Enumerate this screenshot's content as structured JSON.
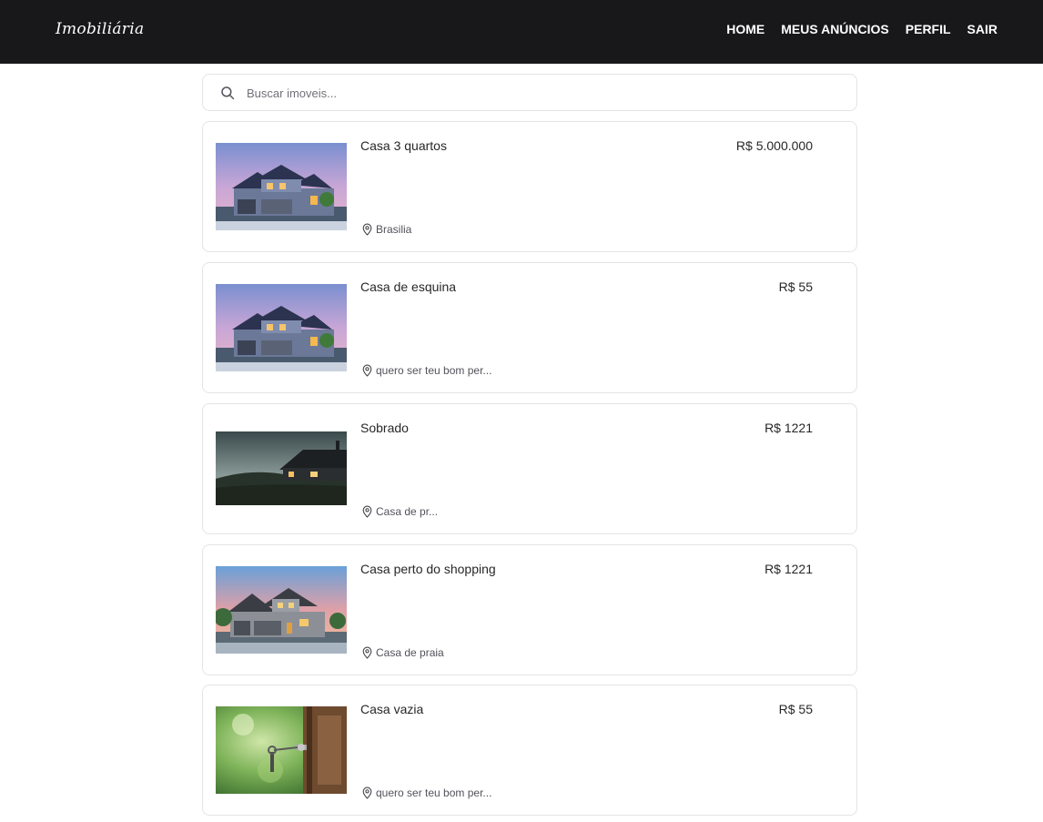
{
  "navbar": {
    "brand": "Imobiliária",
    "links": [
      "HOME",
      "MEUS ANÚNCIOS",
      "PERFIL",
      "SAIR"
    ]
  },
  "search": {
    "placeholder": "Buscar imoveis...",
    "value": ""
  },
  "listings": [
    {
      "title": "Casa 3 quartos",
      "price": "R$ 5.000.000",
      "location": "Brasilia",
      "image": "house-dusk-blue"
    },
    {
      "title": "Casa de esquina",
      "price": "R$ 55",
      "location": "quero ser teu bom per...",
      "image": "house-dusk-blue"
    },
    {
      "title": "Sobrado",
      "price": "R$ 1221",
      "location": "Casa de pr...",
      "image": "house-night-hill"
    },
    {
      "title": "Casa perto do shopping",
      "price": "R$ 1221",
      "location": "Casa de praia",
      "image": "house-sunset-gray"
    },
    {
      "title": "Casa vazia",
      "price": "R$ 55",
      "location": "quero ser teu bom per...",
      "image": "key-in-door"
    }
  ],
  "icons": {
    "search": "search-icon",
    "location": "map-pin-icon"
  },
  "colors": {
    "navbar_bg": "#18181b",
    "card_border": "#e4e4e7"
  }
}
